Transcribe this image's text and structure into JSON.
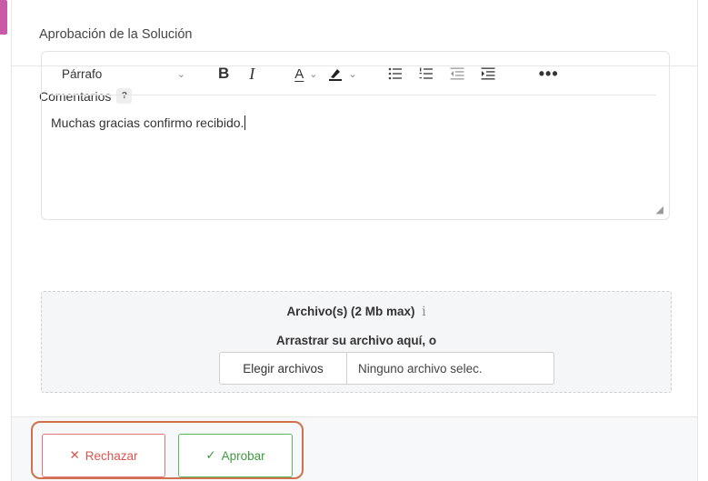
{
  "header": {
    "title": "Aprobación de la Solución"
  },
  "comments": {
    "label": "Comentarios",
    "help": "?",
    "toolbar": {
      "format": "Párrafo",
      "bold": "B",
      "italic": "I",
      "font_color": "A",
      "more": "•••"
    },
    "text": "Muchas gracias confirmo recibido."
  },
  "upload": {
    "title": "Archivo(s) (2 Mb max)",
    "info": "i",
    "drag_text": "Arrastrar su archivo aquí, o",
    "choose_button": "Elegir archivos",
    "status": "Ninguno archivo selec."
  },
  "actions": {
    "reject": {
      "icon": "close-icon",
      "label": "Rechazar",
      "color": "#d9534f"
    },
    "approve": {
      "icon": "check-icon",
      "label": "Aprobar",
      "color": "#3e9b3e"
    },
    "highlight_color": "#d0704c"
  }
}
